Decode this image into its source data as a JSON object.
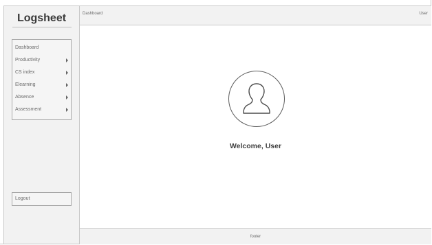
{
  "app": {
    "title": "Logsheet"
  },
  "sidebar": {
    "items": [
      {
        "label": "Dashboard",
        "has_submenu": false,
        "icon": ""
      },
      {
        "label": "Productivity",
        "has_submenu": true,
        "icon": "chevron-right-icon"
      },
      {
        "label": "CS index",
        "has_submenu": true,
        "icon": "chevron-right-icon"
      },
      {
        "label": "Elearning",
        "has_submenu": true,
        "icon": "chevron-right-icon"
      },
      {
        "label": "Absence",
        "has_submenu": true,
        "icon": "chevron-right-icon"
      },
      {
        "label": "Assessment",
        "has_submenu": true,
        "icon": "chevron-right-icon"
      }
    ],
    "logout_label": "Logout"
  },
  "header": {
    "breadcrumb": "Dashboard",
    "user_label": "User"
  },
  "main": {
    "avatar_icon": "user-avatar-icon",
    "welcome_text": "Welcome, User"
  },
  "footer": {
    "text": "footer"
  },
  "colors": {
    "panel_bg": "#f2f2f2",
    "border": "#c8c8c8",
    "text": "#6a6a6a",
    "heading": "#3f3f3f"
  }
}
